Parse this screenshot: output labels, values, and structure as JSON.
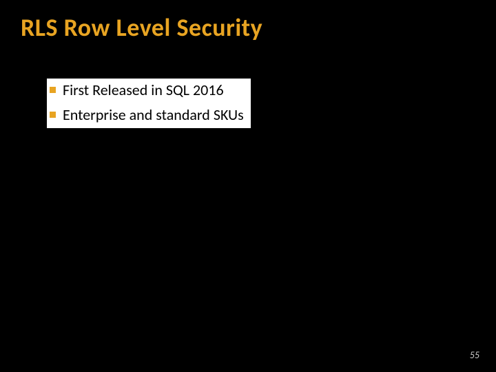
{
  "title": "RLS Row Level Security",
  "bullets": [
    "First Released in SQL 2016",
    "Enterprise and standard SKUs"
  ],
  "pageNumber": "55"
}
